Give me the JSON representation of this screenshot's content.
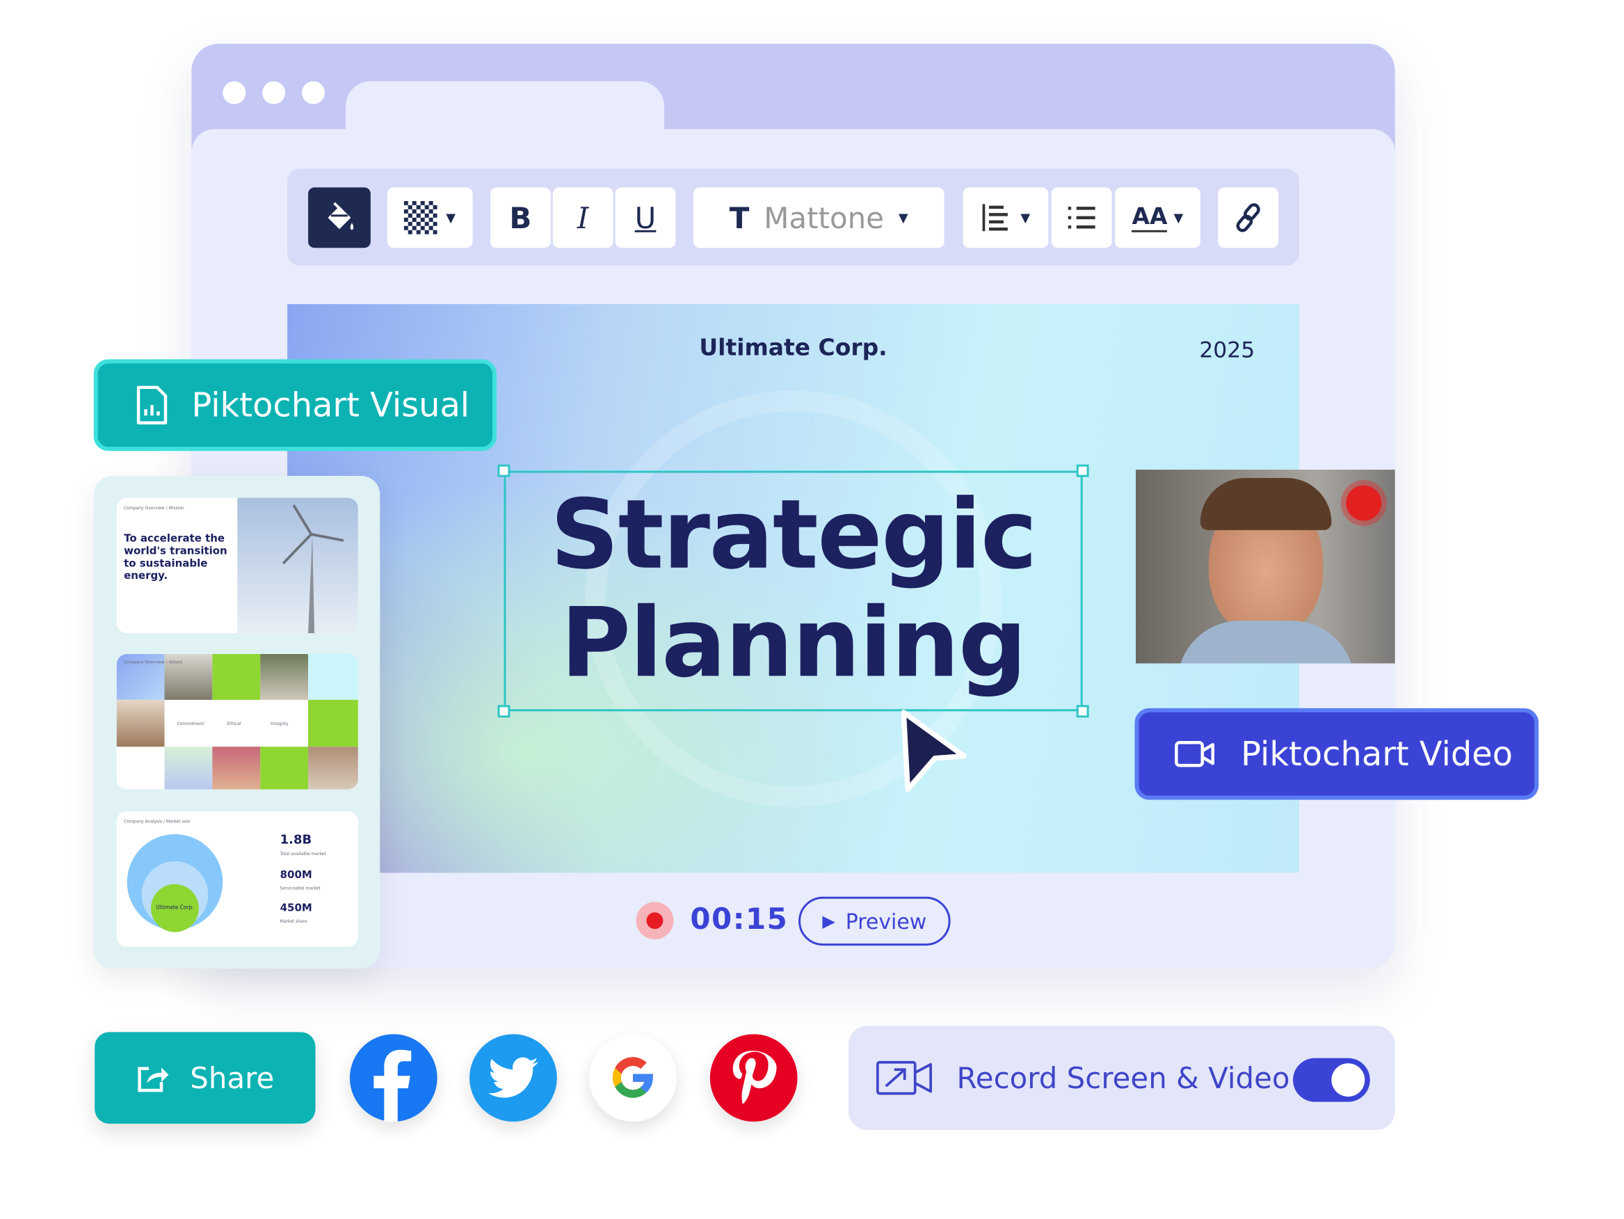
{
  "toolbar": {
    "font_name": "Mattone",
    "bold": "B",
    "italic": "I",
    "underline": "U",
    "text_icon": "T",
    "size_label": "AA"
  },
  "slide": {
    "company": "Ultimate Corp.",
    "year": "2025",
    "title_line1": "Strategic",
    "title_line2": "Planning"
  },
  "badges": {
    "visual": "Piktochart Visual",
    "video": "Piktochart Video"
  },
  "thumbnails": [
    {
      "breadcrumb": "Company Overview / Mission",
      "text": "To accelerate the world's transition to sustainable energy."
    },
    {
      "breadcrumb": "Company Overview / Values",
      "values": [
        "Commitment",
        "Ethical",
        "Integrity"
      ]
    },
    {
      "breadcrumb": "Company Analysis / Market size",
      "center": "Ultimate Corp.",
      "stats": [
        {
          "value": "1.8B",
          "label": "Total available market"
        },
        {
          "value": "800M",
          "label": "Serviceable market"
        },
        {
          "value": "450M",
          "label": "Market share"
        }
      ]
    }
  ],
  "recording": {
    "time": "00:15",
    "preview_label": "Preview"
  },
  "bottom": {
    "share_label": "Share",
    "record_label": "Record Screen & Video",
    "toggle_on": true,
    "socials": [
      "facebook-icon",
      "twitter-icon",
      "google-icon",
      "pinterest-icon"
    ]
  },
  "colors": {
    "teal": "#0db3b3",
    "indigo": "#3b43d6",
    "navy": "#1c2160",
    "window": "#c5c8f5"
  }
}
